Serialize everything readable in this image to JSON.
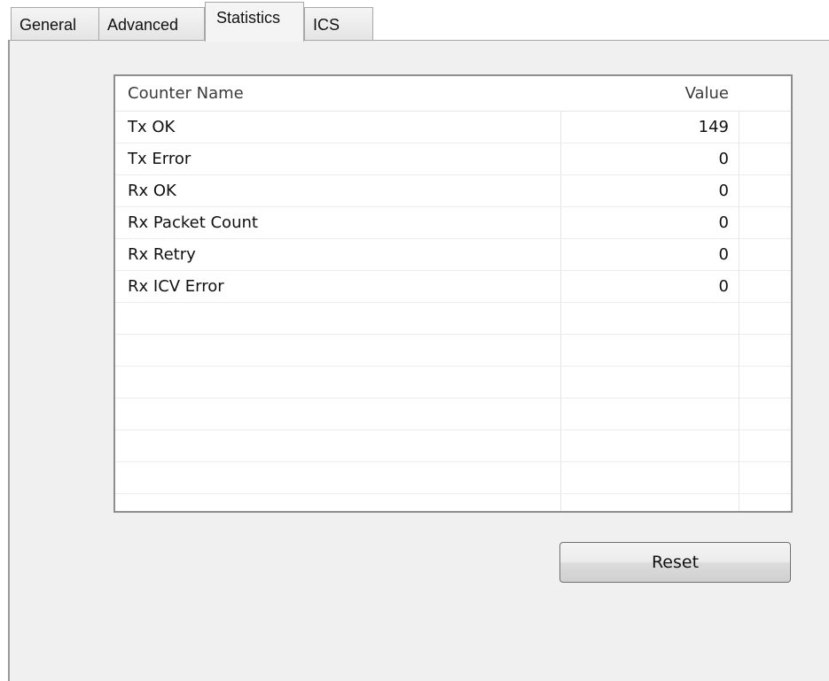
{
  "tabs": [
    {
      "label": "General",
      "selected": false
    },
    {
      "label": "Advanced",
      "selected": false
    },
    {
      "label": "Statistics",
      "selected": true
    },
    {
      "label": "ICS",
      "selected": false
    }
  ],
  "counters": {
    "columns": {
      "name": "Counter Name",
      "value": "Value"
    },
    "rows": [
      {
        "name": "Tx OK",
        "value": "149"
      },
      {
        "name": "Tx Error",
        "value": "0"
      },
      {
        "name": "Rx OK",
        "value": "0"
      },
      {
        "name": "Rx Packet Count",
        "value": "0"
      },
      {
        "name": "Rx Retry",
        "value": "0"
      },
      {
        "name": "Rx ICV Error",
        "value": "0"
      }
    ]
  },
  "buttons": {
    "reset_label": "Reset"
  },
  "colors": {
    "panel_background": "#f0f0f0",
    "list_background": "#ffffff",
    "border": "#8e8e8e"
  }
}
